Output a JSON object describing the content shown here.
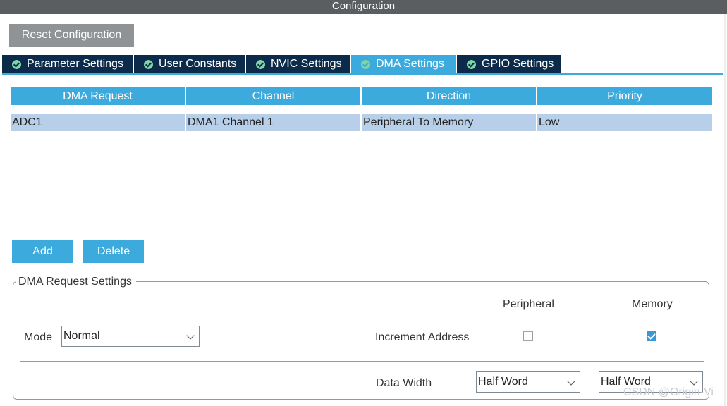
{
  "window": {
    "title": "Configuration"
  },
  "toolbar": {
    "reset_label": "Reset Configuration"
  },
  "tabs": [
    {
      "label": "Parameter Settings",
      "active": false
    },
    {
      "label": "User Constants",
      "active": false
    },
    {
      "label": "NVIC Settings",
      "active": false
    },
    {
      "label": "DMA Settings",
      "active": true
    },
    {
      "label": "GPIO Settings",
      "active": false
    }
  ],
  "table": {
    "headers": [
      "DMA Request",
      "Channel",
      "Direction",
      "Priority"
    ],
    "rows": [
      [
        "ADC1",
        "DMA1 Channel 1",
        "Peripheral To Memory",
        "Low"
      ]
    ]
  },
  "actions": {
    "add_label": "Add",
    "delete_label": "Delete"
  },
  "settings": {
    "legend": "DMA Request Settings",
    "mode_label": "Mode",
    "mode_value": "Normal",
    "peripheral_header": "Peripheral",
    "memory_header": "Memory",
    "increment_label": "Increment Address",
    "increment_peripheral": false,
    "increment_memory": true,
    "data_width_label": "Data Width",
    "data_width_peripheral": "Half Word",
    "data_width_memory": "Half Word"
  },
  "watermark": "CSDN @Origin-Vi",
  "colors": {
    "accent": "#3caadc",
    "tab_dark": "#0c2b4b",
    "row_selected": "#b7cfe8",
    "button_gray": "#8f9396"
  }
}
